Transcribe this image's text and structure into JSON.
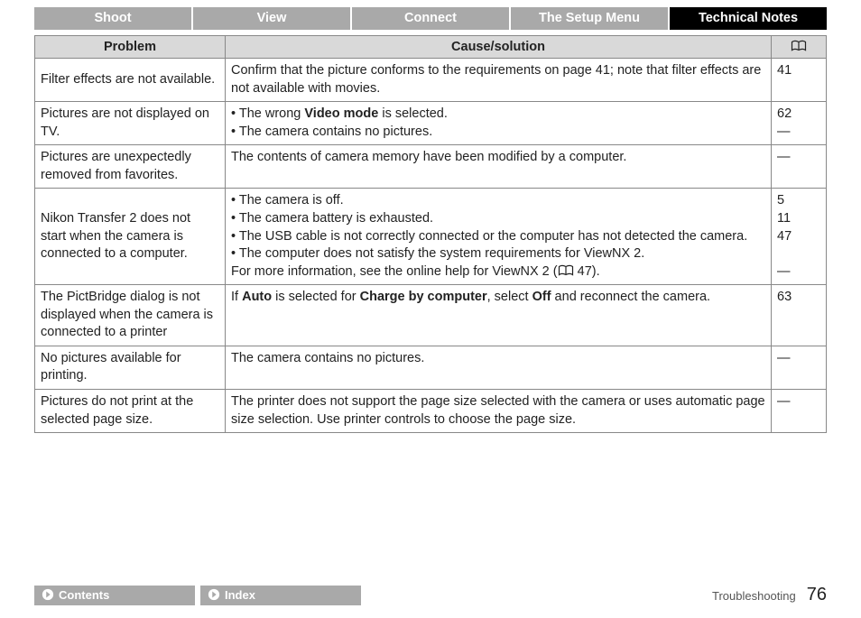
{
  "tabs": {
    "shoot": "Shoot",
    "view": "View",
    "connect": "Connect",
    "setup": "The Setup Menu",
    "technotes": "Technical Notes"
  },
  "table": {
    "head": {
      "problem": "Problem",
      "cause": "Cause/solution"
    },
    "rows": {
      "r1": {
        "problem": "Filter effects are not available.",
        "cause": "Confirm that the picture conforms to the requirements on page 41; note that filter effects are not available with movies.",
        "page": "41"
      },
      "r2": {
        "problem": "Pictures are not displayed on TV.",
        "c1a": "The wrong ",
        "c1b": "Video mode",
        "c1c": " is selected.",
        "c2": "The camera contains no pictures.",
        "page": "62\n—"
      },
      "r3": {
        "problem": "Pictures are unexpectedly removed from favorites.",
        "cause": "The contents of camera memory have been modified by a computer.",
        "page": "—"
      },
      "r4": {
        "problem": "Nikon Transfer 2 does not start when the camera is connected to a computer.",
        "c1": "The camera is off.",
        "c2": "The camera battery is exhausted.",
        "c3": "The USB cable is not correctly connected or the computer has not detected the camera.",
        "c4": "The computer does not satisfy the system requirements for ViewNX 2.",
        "more_a": "For more information, see the online help for ViewNX 2 (",
        "more_b": " 47).",
        "page": "5\n11\n47\n\n—"
      },
      "r5": {
        "problem": "The PictBridge dialog is not displayed when the camera is connected to a printer",
        "c_a": "If ",
        "c_b": "Auto",
        "c_c": " is selected for ",
        "c_d": "Charge by computer",
        "c_e": ", select ",
        "c_f": "Off",
        "c_g": " and reconnect the camera.",
        "page": "63"
      },
      "r6": {
        "problem": "No pictures available for printing.",
        "cause": "The camera contains no pictures.",
        "page": "—"
      },
      "r7": {
        "problem": "Pictures do not print at the selected page size.",
        "cause": "The printer does not support the page size selected with the camera or uses automatic page size selection. Use printer controls to choose the page size.",
        "page": "—"
      }
    }
  },
  "footer": {
    "contents": "Contents",
    "index": "Index",
    "section": "Troubleshooting",
    "page": "76"
  }
}
